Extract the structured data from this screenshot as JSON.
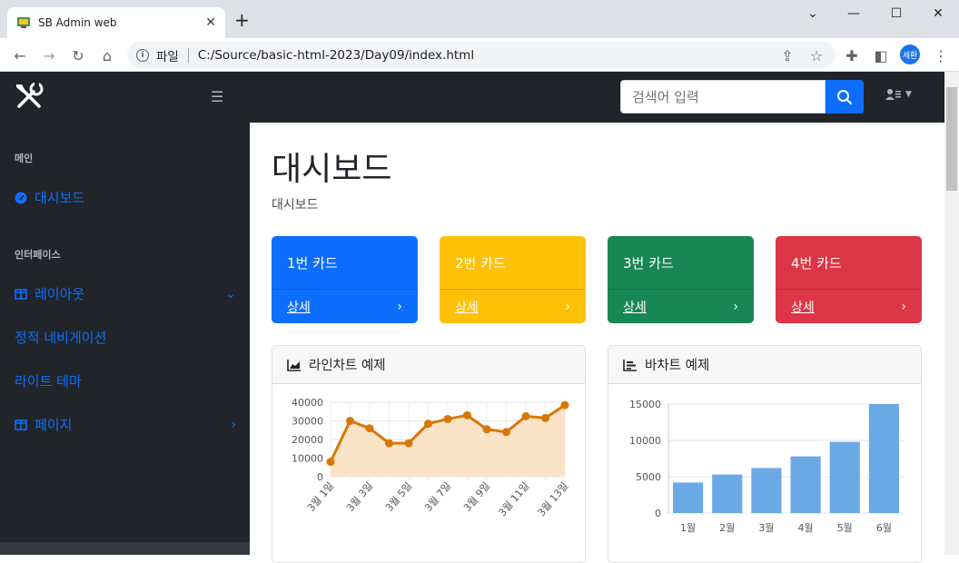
{
  "browser": {
    "tab_title": "SB Admin web",
    "url_prefix": "파일",
    "url": "C:/Source/basic-html-2023/Day09/index.html",
    "profile_label": "세환"
  },
  "topnav": {
    "search_placeholder": "검색어 입력"
  },
  "sidebar": {
    "heading_main": "메인",
    "dashboard": "대시보드",
    "heading_interface": "인터페이스",
    "layout": "레이아웃",
    "static_nav": "정적 네비게이션",
    "light_theme": "라이트 테마",
    "pages": "페이지"
  },
  "main": {
    "title": "대시보드",
    "breadcrumb": "대시보드",
    "cards": [
      {
        "title": "1번 카드",
        "link": "상세",
        "color": "#0d6efd"
      },
      {
        "title": "2번 카드",
        "link": "상세",
        "color": "#ffc107"
      },
      {
        "title": "3번 카드",
        "link": "상세",
        "color": "#198754"
      },
      {
        "title": "4번 카드",
        "link": "상세",
        "color": "#dc3545"
      }
    ],
    "area_title": "라인차트 예제",
    "bar_title": "바차트 예제"
  },
  "chart_data": [
    {
      "type": "area",
      "x": [
        "3월 1일",
        "3월 2일",
        "3월 3일",
        "3월 4일",
        "3월 5일",
        "3월 6일",
        "3월 7일",
        "3월 8일",
        "3월 9일",
        "3월 10일",
        "3월 11일",
        "3월 12일",
        "3월 13일"
      ],
      "x_tick_labels": [
        "3월 1일",
        "3월 3일",
        "3월 5일",
        "3월 7일",
        "3월 9일",
        "3월 11일",
        "3월 13일"
      ],
      "values": [
        8000,
        30000,
        26000,
        18000,
        18000,
        28500,
        31000,
        33000,
        25500,
        24000,
        32500,
        31500,
        38500
      ],
      "ylim": [
        0,
        40000
      ],
      "yticks": [
        0,
        10000,
        20000,
        30000,
        40000
      ],
      "line_color": "#d97706",
      "fill_color": "#fbe3c8",
      "grid": true
    },
    {
      "type": "bar",
      "categories": [
        "1월",
        "2월",
        "3월",
        "4월",
        "5월",
        "6월"
      ],
      "values": [
        4200,
        5300,
        6200,
        7800,
        9800,
        15000
      ],
      "ylim": [
        0,
        15000
      ],
      "yticks": [
        0,
        5000,
        10000,
        15000
      ],
      "bar_color": "#6aa9e6",
      "grid": true
    }
  ]
}
